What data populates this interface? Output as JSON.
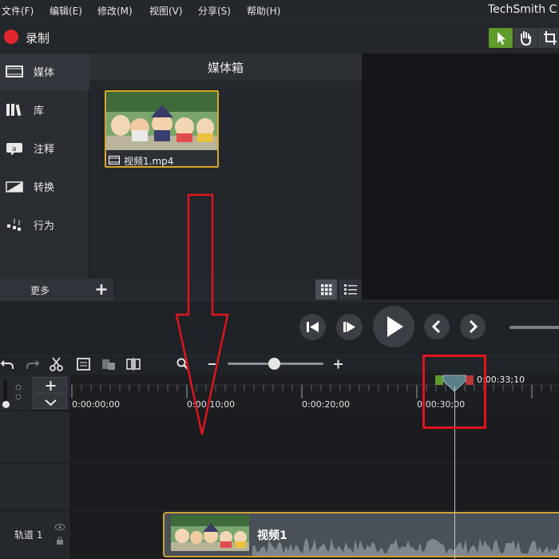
{
  "menu": {
    "file": "文件(F)",
    "edit": "编辑(E)",
    "modify": "修改(M)",
    "view": "视图(V)",
    "share": "分享(S)",
    "help": "帮助(H)",
    "app_title": "TechSmith C"
  },
  "record": {
    "label": "录制"
  },
  "sidebar": {
    "items": [
      {
        "label": "媒体",
        "icon": "film-icon"
      },
      {
        "label": "库",
        "icon": "library-icon"
      },
      {
        "label": "注释",
        "icon": "annotation-icon"
      },
      {
        "label": "转换",
        "icon": "transition-icon"
      },
      {
        "label": "行为",
        "icon": "behavior-icon"
      }
    ],
    "more": "更多"
  },
  "media_bin": {
    "title": "媒体箱",
    "items": [
      {
        "name": "视频1.mp4"
      }
    ]
  },
  "timeline": {
    "ruler_labels": [
      "0:00:00;00",
      "0:00:10;00",
      "0:00:20;00",
      "0:00:30;00"
    ],
    "playhead_time": "0:00:33;10",
    "track_label": "轨道 1",
    "clip_name": "视频1"
  },
  "colors": {
    "accent_green": "#5e9b2b",
    "record_red": "#e1262b",
    "selection_gold": "#d7a629",
    "annotation_red": "#e0141c"
  }
}
